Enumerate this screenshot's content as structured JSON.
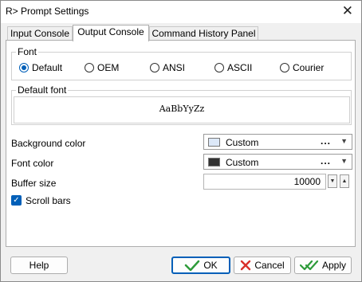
{
  "window": {
    "title": "R> Prompt Settings"
  },
  "tabs": [
    {
      "label": "Input Console"
    },
    {
      "label": "Output Console"
    },
    {
      "label": "Command History Panel"
    }
  ],
  "font_group": {
    "label": "Font",
    "selected": "Default",
    "options": [
      "Default",
      "OEM",
      "ANSI",
      "ASCII",
      "Courier"
    ]
  },
  "default_font_group": {
    "label": "Default font",
    "preview": "AaBbYyZz"
  },
  "background_color": {
    "label": "Background color",
    "value": "Custom",
    "swatch": "#dce8f8"
  },
  "font_color": {
    "label": "Font color",
    "value": "Custom",
    "swatch": "#333333"
  },
  "buffer_size": {
    "label": "Buffer size",
    "value": "10000"
  },
  "scroll_bars": {
    "label": "Scroll bars",
    "checked": true
  },
  "buttons": {
    "help": "Help",
    "ok": "OK",
    "cancel": "Cancel",
    "apply": "Apply"
  },
  "icons": {
    "close": "close-icon",
    "ok": "check-icon",
    "cancel": "x-icon",
    "apply": "double-check-icon"
  },
  "colors": {
    "accent": "#005fb8",
    "ok_green": "#2e9b3a",
    "cancel_red": "#d9302a"
  }
}
